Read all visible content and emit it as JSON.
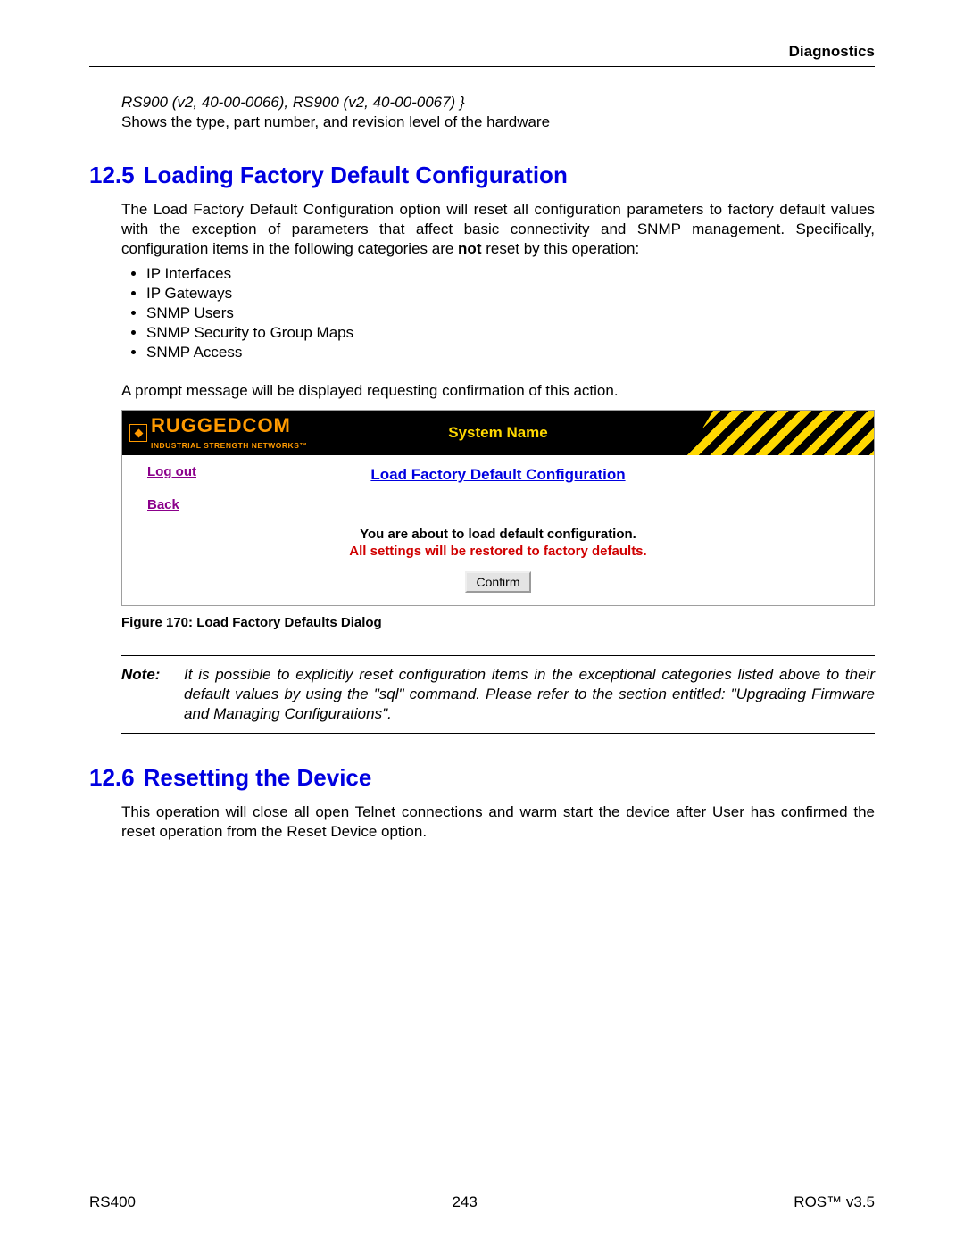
{
  "header": {
    "right": "Diagnostics"
  },
  "intro": {
    "line1": "RS900 (v2, 40-00-0066), RS900 (v2, 40-00-0067) }",
    "line2": "Shows the type, part number, and revision level of the hardware"
  },
  "section125": {
    "num": "12.5",
    "title": "Loading Factory Default Configuration",
    "para_pre": "The Load Factory Default Configuration option will reset all configuration parameters to factory default values with the exception of parameters that affect basic connectivity and SNMP management. Specifically, configuration items in the following categories are ",
    "para_bold": "not",
    "para_post": " reset by this operation:",
    "bullets": [
      "IP Interfaces",
      "IP Gateways",
      "SNMP Users",
      "SNMP Security to Group Maps",
      "SNMP Access"
    ],
    "prompt_msg": "A prompt message will be displayed requesting confirmation of this action."
  },
  "screenshot": {
    "logo_main": "RUGGEDCOM",
    "logo_tagline": "INDUSTRIAL STRENGTH NETWORKS™",
    "banner_title": "System Name",
    "nav": {
      "logout": "Log out",
      "back": "Back"
    },
    "page_title": "Load Factory Default Configuration",
    "warn1": "You are about to load default configuration.",
    "warn2": "All settings will be restored to factory defaults.",
    "confirm_label": "Confirm"
  },
  "figure_caption": "Figure 170: Load Factory Defaults Dialog",
  "note": {
    "label": "Note:",
    "text": "It is possible to explicitly reset configuration items in the exceptional categories listed above to their default values by using the \"sql\" command. Please refer to the section entitled: \"Upgrading Firmware and Managing Configurations\"."
  },
  "section126": {
    "num": "12.6",
    "title": "Resetting the Device",
    "para": "This operation will close all open Telnet connections and warm start the device after User has confirmed the reset operation from the Reset Device option."
  },
  "footer": {
    "left": "RS400",
    "center": "243",
    "right": "ROS™  v3.5"
  }
}
